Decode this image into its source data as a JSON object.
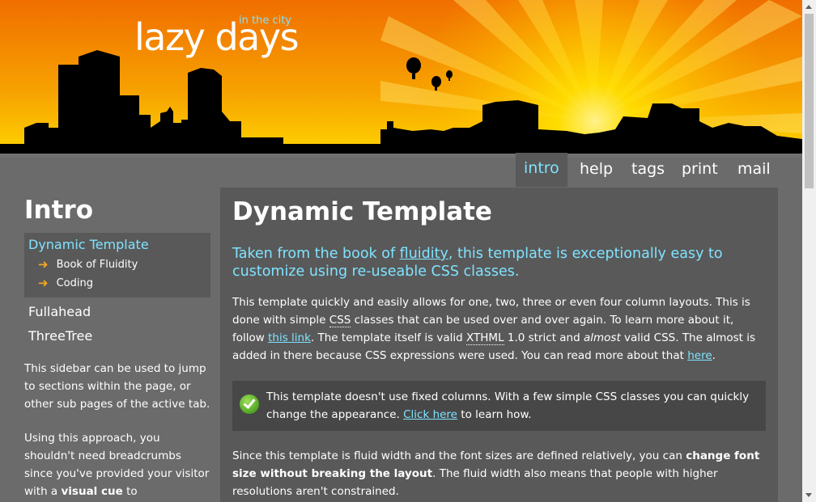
{
  "header": {
    "logo_main": "lazy days",
    "logo_sub": "in the city"
  },
  "nav": {
    "tabs": [
      "intro",
      "help",
      "tags",
      "print",
      "mail"
    ],
    "active": "intro"
  },
  "sidebar": {
    "title": "Intro",
    "active_item": "Dynamic Template",
    "sub_items": [
      "Book of Fluidity",
      "Coding"
    ],
    "links": [
      "Fullahead",
      "ThreeTree"
    ],
    "text1": "This sidebar can be used to jump to sections within the page, or other sub pages of the active tab.",
    "text2_start": "Using this approach, you shouldn't need breadcrumbs since you've provided your visitor with a ",
    "text2_bold": "visual cue",
    "text2_end": " to"
  },
  "content": {
    "title": "Dynamic Template",
    "lead_start": "Taken from the book of ",
    "lead_link": "fluidity",
    "lead_end": ", this template is exceptionally easy to customize using re-useable CSS classes.",
    "p1_a": "This template quickly and easily allows for one, two, three or even four column layouts. This is done with simple ",
    "p1_abbr1": "CSS",
    "p1_b": " classes that can be used over and over again. To learn more about it, follow ",
    "p1_link1": "this link",
    "p1_c": ". The template itself is valid ",
    "p1_abbr2": "XTHML",
    "p1_d": " 1.0 strict and ",
    "p1_em": "almost",
    "p1_e": " valid CSS. The almost is added in there because CSS expressions were used. You can read more about that ",
    "p1_link2": "here",
    "p1_f": ".",
    "notice_a": "This template doesn't use fixed columns. With a few simple CSS classes you can quickly change the appearance. ",
    "notice_link": "Click here",
    "notice_b": " to learn how.",
    "p2_a": "Since this template is fluid width and the font sizes are defined relatively, you can ",
    "p2_bold": "change font size without breaking the layout",
    "p2_b": ". The fluid width also means that people with higher resolutions aren't constrained."
  },
  "colors": {
    "accent": "#7fe3ff",
    "sky_top": "#f07a00",
    "sky_bottom": "#ffd200",
    "panel": "#595959",
    "background": "#6b6b6b"
  }
}
